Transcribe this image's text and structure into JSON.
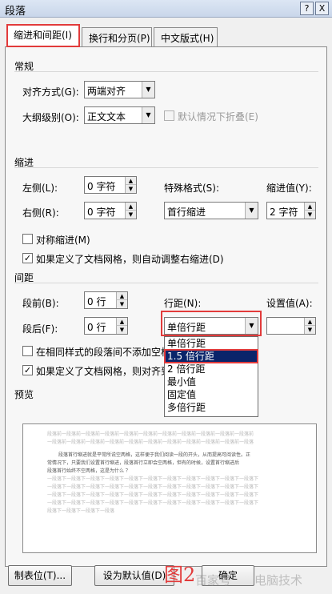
{
  "window": {
    "title": "段落",
    "help_label": "?",
    "close_label": "X"
  },
  "tabs": [
    {
      "label": "缩进和间距(I)"
    },
    {
      "label": "换行和分页(P)"
    },
    {
      "label": "中文版式(H)"
    }
  ],
  "general": {
    "heading": "常规",
    "alignment_label": "对齐方式(G):",
    "alignment_value": "两端对齐",
    "outline_label": "大纲级别(O):",
    "outline_value": "正文文本",
    "collapse_label": "默认情况下折叠(E)",
    "collapse_checked": false
  },
  "indent": {
    "heading": "缩进",
    "left_label": "左侧(L):",
    "left_value": "0 字符",
    "right_label": "右侧(R):",
    "right_value": "0 字符",
    "special_label": "特殊格式(S):",
    "special_value": "首行缩进",
    "by_label": "缩进值(Y):",
    "by_value": "2 字符",
    "mirror_label": "对称缩进(M)",
    "mirror_checked": false,
    "auto_adjust_label": "如果定义了文档网格，则自动调整右缩进(D)",
    "auto_adjust_checked": true,
    "check_mark": "✓"
  },
  "spacing": {
    "heading": "间距",
    "before_label": "段前(B):",
    "before_value": "0 行",
    "after_label": "段后(F):",
    "after_value": "0 行",
    "line_spacing_label": "行距(N):",
    "line_spacing_value": "单倍行距",
    "at_label": "设置值(A):",
    "at_value": "",
    "no_space_label": "在相同样式的段落间不添加空格",
    "no_space_checked": false,
    "snap_grid_label": "如果定义了文档网格，则对齐到",
    "snap_grid_checked": true
  },
  "line_spacing_options": [
    "单倍行距",
    "1.5 倍行距",
    "2 倍行距",
    "最小值",
    "固定值",
    "多倍行距"
  ],
  "line_spacing_highlighted_index": 1,
  "preview": {
    "heading": "预览",
    "sample_lines": [
      "段落前一段落前一段落前一段落前一段落前一段落前一段落前一段落前一段落前一段落前一段落前",
      "一段落前一段落前一段落前一段落前一段落前一段落前一段落前一段落前一段落前一段落前一段落",
      "段落首行缩进就是平常所说空两格，这样便于我们阅读一段的开头，从而提高可阅读性。正",
      "常情况下，只要我们设置首行缩进，段落首行立即会空两格，但有的时候，设置首行缩进后",
      "段落首行始终不空两格，这是为什么 ？",
      "一段落下一段落下一段落下一段落下一段落下一段落下一段落下一段落下一段落下一段落下一段落下",
      "一段落下一段落下一段落下一段落下一段落下一段落下一段落下一段落下一段落下一段落下一段落下",
      "一段落下一段落下一段落下一段落下一段落下一段落下一段落下一段落下一段落下一段落下一段落下",
      "一段落下一段落下一段落下一段落下一段落下一段落下一段落下一段落下一段落下一段落下一段落下",
      "段落下一段落下一段落下一段落"
    ]
  },
  "buttons": {
    "tabs_label": "制表位(T)...",
    "default_label": "设为默认值(D)",
    "ok_label": "确定"
  },
  "overlay": {
    "figure_label": "图2",
    "watermark_left": "百家号",
    "watermark_right": "电脑技术"
  },
  "colors": {
    "highlight_red": "#e23b3b",
    "selection_blue": "#0a246a"
  }
}
